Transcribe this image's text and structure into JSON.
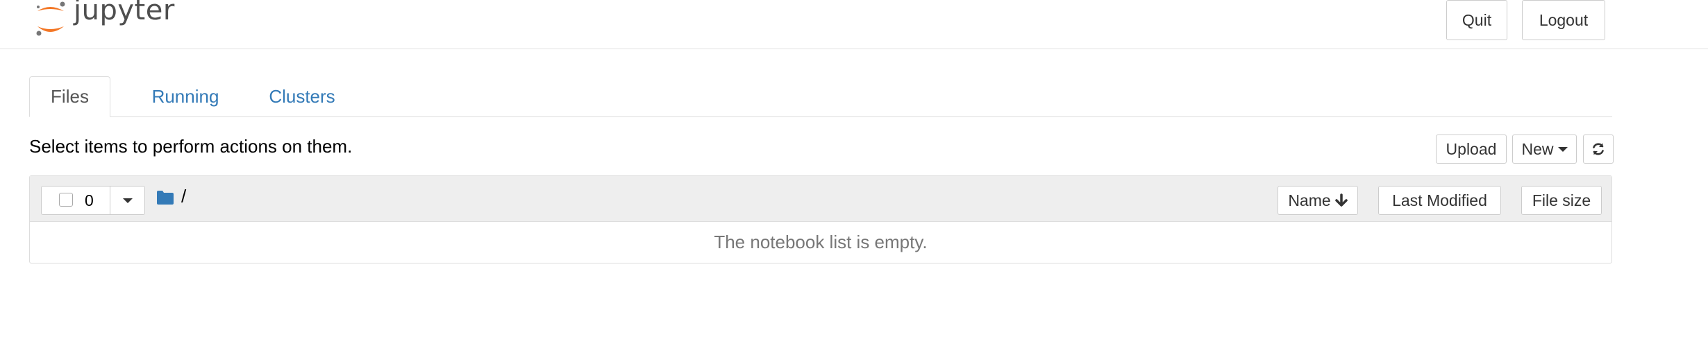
{
  "header": {
    "logo_text": "jupyter",
    "logo_colors": {
      "orange": "#f37726",
      "gray": "#767677"
    },
    "quit_label": "Quit",
    "logout_label": "Logout"
  },
  "tabs": [
    {
      "label": "Files",
      "active": true
    },
    {
      "label": "Running",
      "active": false
    },
    {
      "label": "Clusters",
      "active": false
    }
  ],
  "toolbar": {
    "hint": "Select items to perform actions on them.",
    "upload_label": "Upload",
    "new_label": "New",
    "new_icon": "caret-down-icon",
    "refresh_icon": "refresh-icon"
  },
  "file_list": {
    "selected_count": "0",
    "checkbox_checked": false,
    "path": "/",
    "folder_icon": "folder-icon",
    "sort_name_label": "Name",
    "sort_name_icon": "arrow-down-icon",
    "sort_modified_label": "Last Modified",
    "sort_size_label": "File size",
    "empty_message": "The notebook list is empty."
  },
  "colors": {
    "link": "#337ab7",
    "folder": "#337ab7",
    "header_border": "#e0e0e0",
    "list_header_bg": "#eeeeee",
    "muted_text": "#777777"
  }
}
